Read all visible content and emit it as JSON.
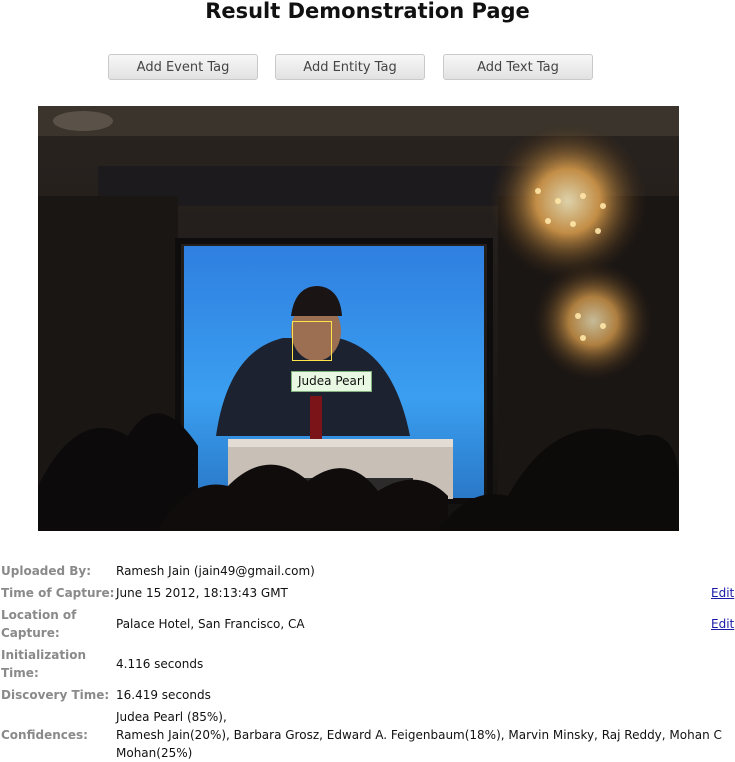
{
  "page": {
    "title": "Result Demonstration Page"
  },
  "toolbar": {
    "add_event_tag": "Add Event Tag",
    "add_entity_tag": "Add Entity Tag",
    "add_text_tag": "Add Text Tag"
  },
  "photo": {
    "face_tag": "Judea Pearl",
    "face_box_color": "#ffe34a",
    "tag_background": "#e9f8e3"
  },
  "details": {
    "uploaded_by": {
      "label": "Uploaded By:",
      "value": "Ramesh Jain (jain49@gmail.com)"
    },
    "time_of_capture": {
      "label": "Time of Capture:",
      "value": "June 15 2012, 18:13:43 GMT",
      "edit": "Edit"
    },
    "location": {
      "label_line1": "Location of",
      "label_line2": "Capture:",
      "value": "Palace Hotel, San Francisco, CA",
      "edit": "Edit"
    },
    "initialization": {
      "label_line1": "Initialization",
      "label_line2": "Time:",
      "value": "4.116 seconds"
    },
    "discovery": {
      "label": "Discovery Time:",
      "value": "16.419 seconds"
    },
    "confidences": {
      "label": "Confidences:",
      "line1": "Judea Pearl (85%),",
      "line2": "Ramesh Jain(20%), Barbara Grosz, Edward A. Feigenbaum(18%), Marvin Minsky, Raj Reddy, Mohan C",
      "line3": "Mohan(25%)"
    }
  },
  "colors": {
    "label_gray": "#8a8a8a",
    "link_blue": "#1a1aa6"
  }
}
